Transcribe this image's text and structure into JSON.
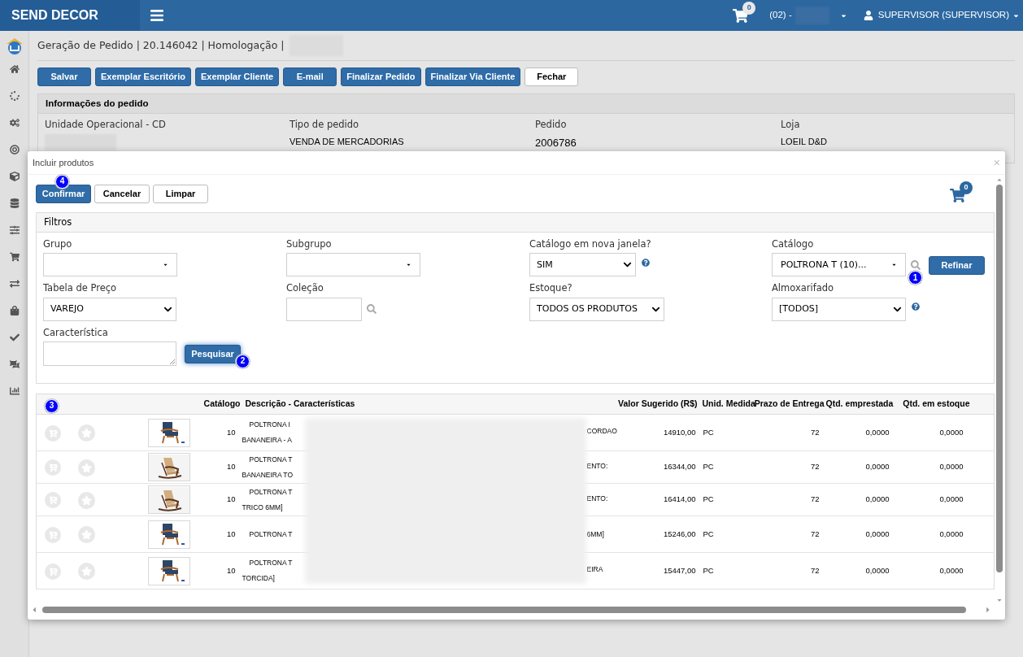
{
  "topbar": {
    "brand": "SEND DECOR",
    "cart_count": "0",
    "store": "(02) -",
    "user": "SUPERVISOR (SUPERVISOR)"
  },
  "page": {
    "breadcrumb": "Geração de Pedido | 20.146042 | Homologação |",
    "buttons": [
      {
        "label": "Salvar",
        "kind": "primary"
      },
      {
        "label": "Exemplar Escritório",
        "kind": "primary"
      },
      {
        "label": "Exemplar Cliente",
        "kind": "primary"
      },
      {
        "label": "E-mail",
        "kind": "primary"
      },
      {
        "label": "Finalizar Pedido",
        "kind": "primary"
      },
      {
        "label": "Finalizar Via Cliente",
        "kind": "primary"
      },
      {
        "label": "Fechar",
        "kind": "default"
      }
    ],
    "order_info": {
      "title": "Informações do pedido",
      "fields": [
        {
          "label": "Unidade Operacional - CD"
        },
        {
          "label": "Tipo de pedido",
          "value": "VENDA DE MERCADORIAS"
        },
        {
          "label": "Pedido",
          "value": "2006786"
        },
        {
          "label": "Loja",
          "value": "LOEIL D&D"
        }
      ]
    }
  },
  "modal": {
    "title": "Incluir produtos",
    "close": "×",
    "buttons": [
      {
        "label": "Confirmar",
        "kind": "primary",
        "step": "4"
      },
      {
        "label": "Cancelar",
        "kind": "default"
      },
      {
        "label": "Limpar",
        "kind": "default"
      }
    ],
    "cart_count": "0",
    "filters": {
      "title": "Filtros",
      "fields": [
        {
          "label": "Grupo",
          "kind": "combo"
        },
        {
          "label": "Subgrupo",
          "kind": "combo"
        },
        {
          "label": "Catálogo em nova janela?",
          "kind": "select",
          "value": "SIM",
          "help": true
        },
        {
          "label": "Catálogo",
          "kind": "combo",
          "value": "POLTRONA T (10)...",
          "search": true,
          "step": "1",
          "button": "Refinar"
        },
        {
          "label": "Tabela de Preço",
          "kind": "select",
          "value": "VAREJO"
        },
        {
          "label": "Coleção",
          "kind": "text",
          "search": true
        },
        {
          "label": "Estoque?",
          "kind": "select",
          "value": "TODOS OS PRODUTOS"
        },
        {
          "label": "Almoxarifado",
          "kind": "select",
          "value": "[TODOS]",
          "help": true
        },
        {
          "label": "Característica",
          "kind": "textarea",
          "button": "Pesquisar",
          "step": "2"
        }
      ]
    },
    "table": {
      "step": "3",
      "columns": [
        "Catálogo",
        "Descrição - Características",
        "Valor Sugerido (R$)",
        "Unid. Medida",
        "Prazo de Entrega",
        "Qtd. emprestada",
        "Qtd. em estoque"
      ],
      "rows": [
        {
          "catalog": "10",
          "desc": [
            "POLTRONA I",
            "BANANEIRA - A"
          ],
          "desc_end": "CORDAO",
          "value": "14910,00",
          "unit": "PC",
          "lead_time": "72",
          "qty_lent": "0,0000",
          "qty_stock": "0,0000"
        },
        {
          "catalog": "10",
          "desc": [
            "POLTRONA T",
            "BANANEIRA TO"
          ],
          "desc_end": "ENTO:",
          "value": "16344,00",
          "unit": "PC",
          "lead_time": "72",
          "qty_lent": "0,0000",
          "qty_stock": "0,0000"
        },
        {
          "catalog": "10",
          "desc": [
            "POLTRONA T",
            "TRICO 6MM]"
          ],
          "desc_end": "ENTO:",
          "value": "16414,00",
          "unit": "PC",
          "lead_time": "72",
          "qty_lent": "0,0000",
          "qty_stock": "0,0000"
        },
        {
          "catalog": "10",
          "desc": [
            "POLTRONA T"
          ],
          "desc_end": "6MM]",
          "value": "15246,00",
          "unit": "PC",
          "lead_time": "72",
          "qty_lent": "0,0000",
          "qty_stock": "0,0000"
        },
        {
          "catalog": "10",
          "desc": [
            "POLTRONA T",
            "TORCIDA]"
          ],
          "desc_end": "EIRA",
          "value": "15447,00",
          "unit": "PC",
          "lead_time": "72",
          "qty_lent": "0,0000",
          "qty_stock": "0,0000"
        }
      ]
    }
  }
}
